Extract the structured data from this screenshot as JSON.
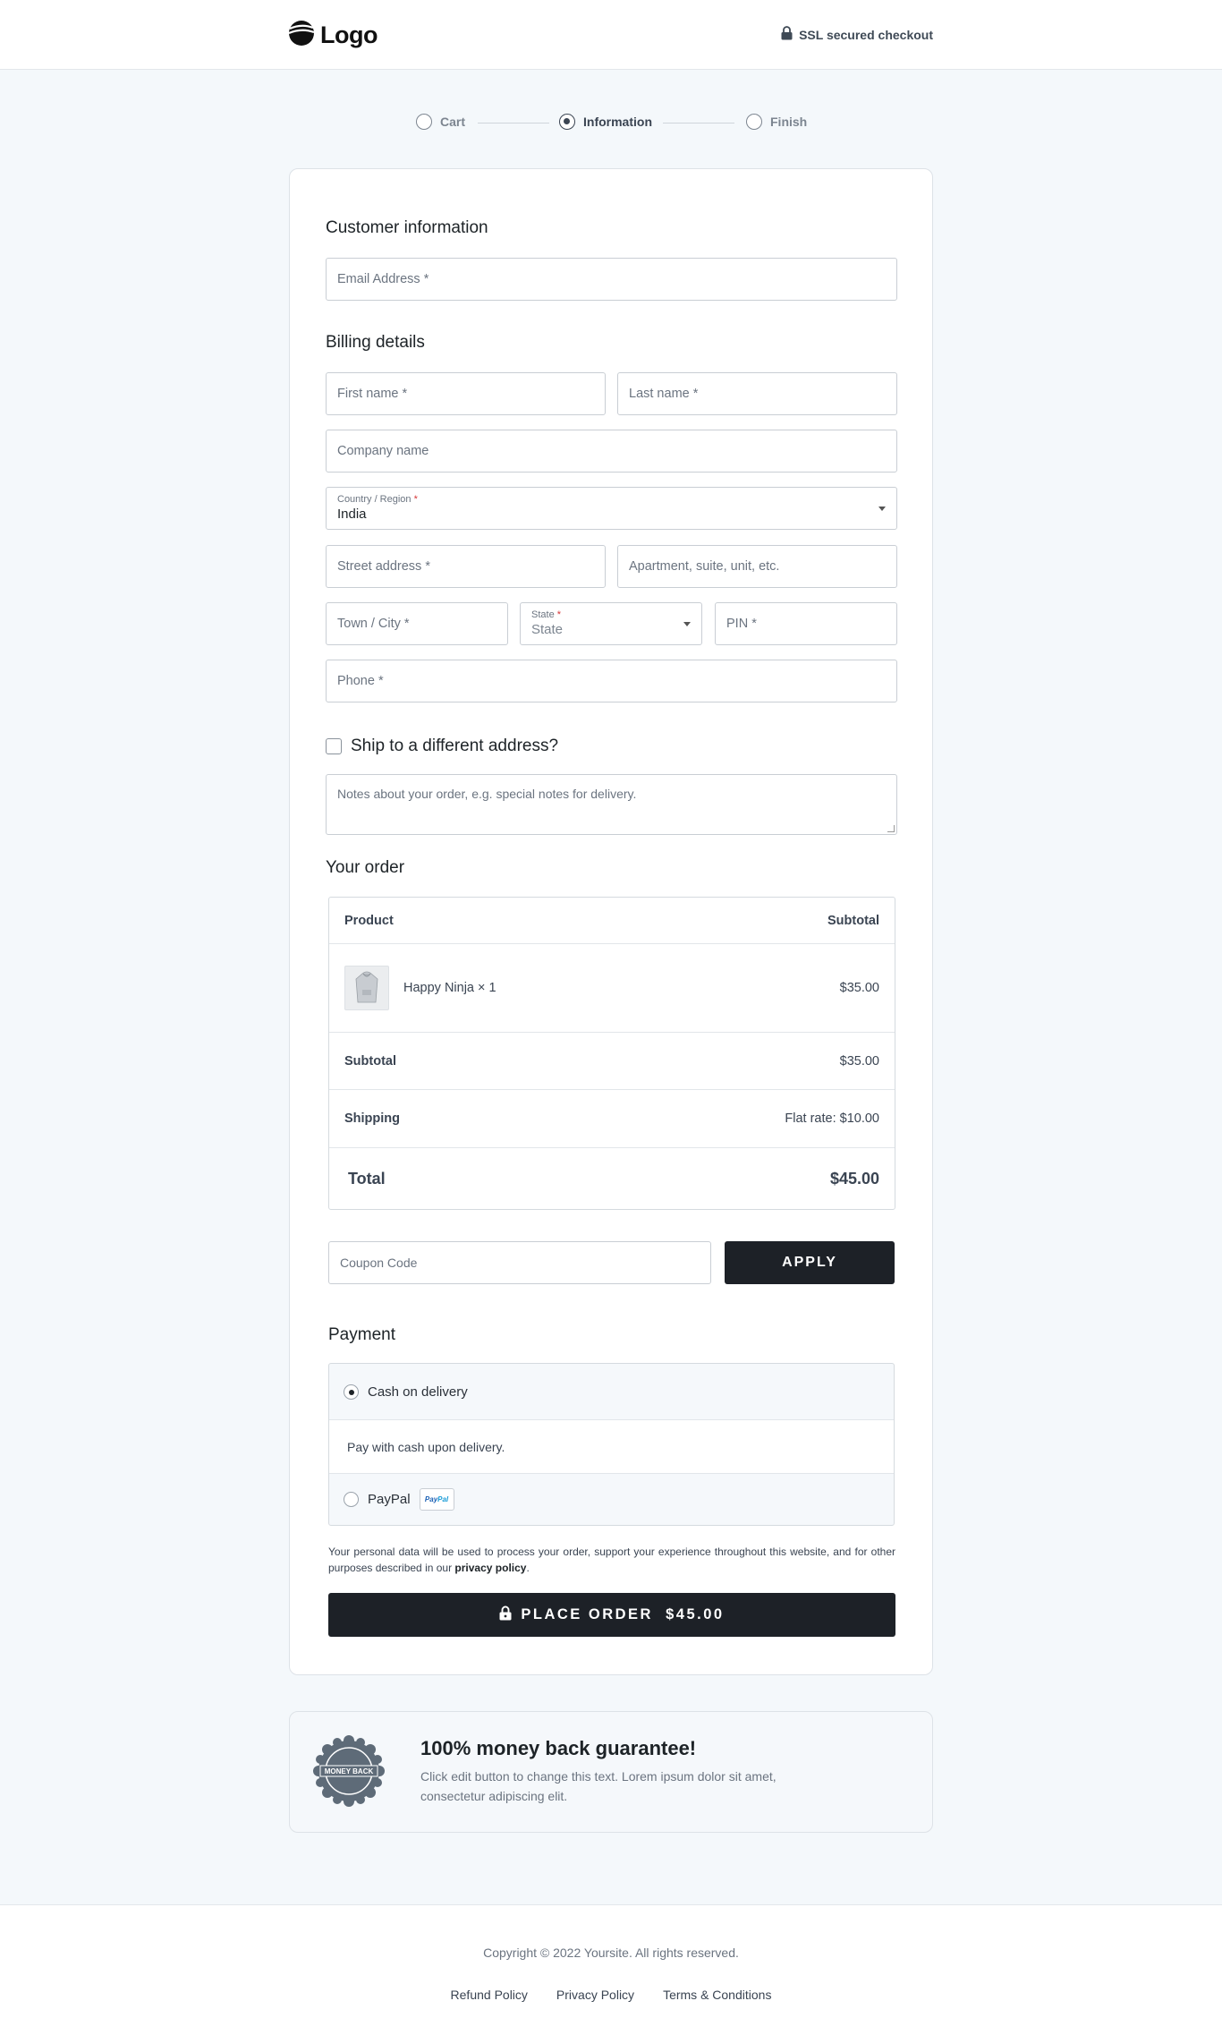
{
  "header": {
    "logo_text": "Logo",
    "ssl_text": "SSL secured checkout"
  },
  "steps": [
    {
      "label": "Cart",
      "state": "done"
    },
    {
      "label": "Information",
      "state": "active"
    },
    {
      "label": "Finish",
      "state": "pending"
    }
  ],
  "customer": {
    "title": "Customer information",
    "email_placeholder": "Email Address *"
  },
  "billing": {
    "title": "Billing details",
    "first_name": "First name *",
    "last_name": "Last name *",
    "company": "Company name",
    "country_label": "Country / Region",
    "country_value": "India",
    "street": "Street address *",
    "apartment": "Apartment, suite, unit, etc.",
    "city": "Town / City *",
    "state_label": "State",
    "state_value": "State",
    "pin": "PIN *",
    "phone": "Phone *",
    "required_mark": "*"
  },
  "shipping_toggle": "Ship to a different address?",
  "notes_placeholder": "Notes about your order, e.g. special notes for delivery.",
  "order": {
    "title": "Your order",
    "header_product": "Product",
    "header_subtotal": "Subtotal",
    "item_name": "Happy Ninja × 1",
    "item_price": "$35.00",
    "subtotal_label": "Subtotal",
    "subtotal_value": "$35.00",
    "shipping_label": "Shipping",
    "shipping_value": "Flat rate: $10.00",
    "total_label": "Total",
    "total_value": "$45.00"
  },
  "coupon": {
    "placeholder": "Coupon Code",
    "button": "APPLY"
  },
  "payment": {
    "title": "Payment",
    "cod_label": "Cash on delivery",
    "cod_desc": "Pay with cash upon delivery.",
    "paypal_label": "PayPal",
    "paypal_badge_a": "Pay",
    "paypal_badge_b": "Pal",
    "selected": "cod"
  },
  "privacy": {
    "text": "Your personal data will be used to process your order, support your experience throughout this website, and for other purposes described in our ",
    "link": "privacy policy",
    "end": "."
  },
  "place_order": "PLACE ORDER  $45.00",
  "guarantee": {
    "title": "100% money back guarantee!",
    "text": "Click edit button to change this text. Lorem ipsum dolor sit amet, consectetur adipiscing elit.",
    "seal_text": "MONEY BACK"
  },
  "footer": {
    "copyright": "Copyright © 2022 Yoursite. All rights reserved.",
    "links": [
      "Refund Policy",
      "Privacy Policy",
      "Terms & Conditions"
    ]
  },
  "colors": {
    "page_bg": "#f4f8fb",
    "button_dark": "#1d2127",
    "required_red": "#d63638"
  }
}
